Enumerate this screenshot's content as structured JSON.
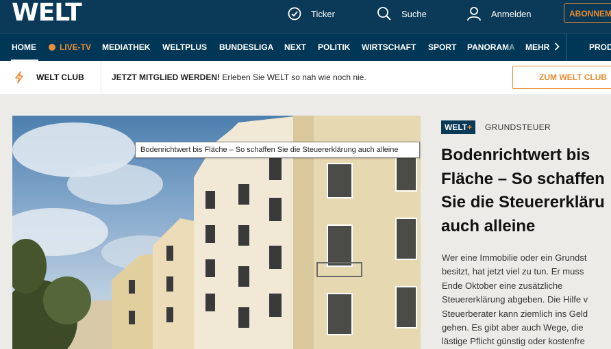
{
  "header": {
    "logo": "WELT",
    "ticker_label": "Ticker",
    "search_label": "Suche",
    "login_label": "Anmelden",
    "abo_label": "ABONNEM"
  },
  "nav": {
    "items": [
      "HOME",
      "LIVE-TV",
      "MEDIATHEK",
      "WELTPLUS",
      "BUNDESLIGA",
      "NEXT",
      "POLITIK",
      "WIRTSCHAFT",
      "SPORT",
      "PANORAMA",
      "MEHR",
      "PROD"
    ]
  },
  "club": {
    "title": "WELT CLUB",
    "cta_bold": "JETZT MITGLIED WERDEN!",
    "cta_text": "Erleben Sie WELT so nah wie noch nie.",
    "button_label": "ZUM WELT CLUB"
  },
  "article": {
    "badge": "WELT",
    "badge_plus": "+",
    "kicker": "GRUNDSTEUER",
    "headline_lines": [
      "Bodenrichtwert bis",
      "Fläche – So schaffen",
      "Sie die Steuererkläru",
      "auch alleine"
    ],
    "intro_lines": [
      "Wer eine Immobilie oder ein Grundst",
      "besitzt, hat jetzt viel zu tun. Er muss",
      "Ende Oktober eine zusätzliche",
      "Steuererklärung abgeben. Die Hilfe v",
      "Steuerberater kann ziemlich ins Geld",
      "gehen. Es gibt aber auch Wege, die",
      "lästige Pflicht günstig oder kostenfre"
    ],
    "image_tooltip": "Bodenrichtwert bis Fläche – So schaffen Sie die Steuererklärung auch alleine"
  },
  "colors": {
    "header_bg": "#0a3a58",
    "nav_bg": "#003756",
    "accent": "#e88f3a",
    "page_bg": "#ecebe7"
  }
}
